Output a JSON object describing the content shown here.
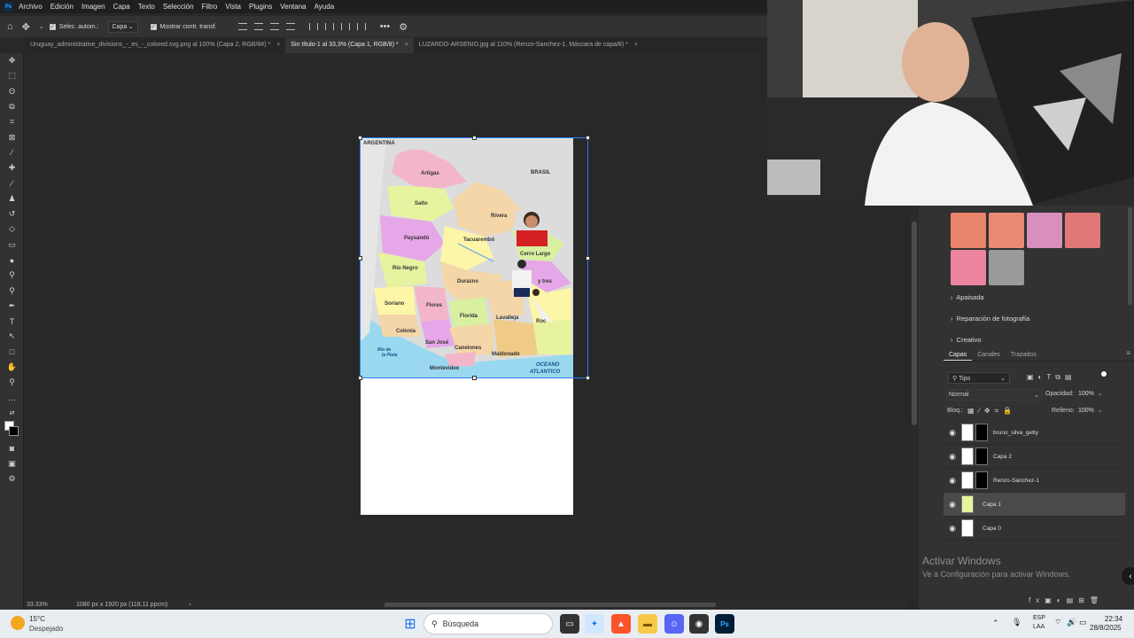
{
  "menu": [
    "Archivo",
    "Edición",
    "Imagen",
    "Capa",
    "Texto",
    "Selección",
    "Filtro",
    "Vista",
    "Plugins",
    "Ventana",
    "Ayuda"
  ],
  "options": {
    "autoselect_label": "Selec. autom.:",
    "autoselect_target": "Capa",
    "transform_label": "Mostrar contr. transf."
  },
  "tabs": [
    {
      "label": "Uruguay_administrative_divisions_-_es_-_colored.svg.png al 100% (Capa 2, RGB/8#) *"
    },
    {
      "label": "Sin título-1 al 33,3% (Capa 1, RGB/8) *"
    },
    {
      "label": "LUZARDO-ARSENIO.jpg al 110% (Renzo-Sanchez-1, Máscara de capa/8) *"
    }
  ],
  "map": {
    "labels": {
      "argentina": "ARGENTINA",
      "brasil": "BRASIL",
      "artigas": "Artigas",
      "salto": "Salto",
      "rivera": "Rivera",
      "paysandu": "Paysandú",
      "tacuarembo": "Tacuarembó",
      "cerro_largo": "Cerro Largo",
      "rio_negro": "Río Negro",
      "durazno": "Durazno",
      "treinta_y_tres": "y tres",
      "soriano": "Soriano",
      "flores": "Flores",
      "florida": "Florida",
      "lavalleja": "Lavalleja",
      "rocha": "Roc",
      "colonia": "Colonia",
      "san_jose": "San José",
      "canelones": "Canelones",
      "maldonado": "Maldonado",
      "montevideo": "Montevideo",
      "rio_de_la_plata_1": "Río de",
      "rio_de_la_plata_2": "la Plata",
      "oceano_1": "OCEANO",
      "oceano_2": "ATLANTICO"
    }
  },
  "status": {
    "zoom": "33.33%",
    "doc_size": "1080 px x 1920 px (118,11 ppcm)"
  },
  "adjustments": {
    "sections": [
      "Apaisada",
      "Reparación de fotografía",
      "Creativo"
    ]
  },
  "layers_panel": {
    "tabs": [
      "Capas",
      "Canales",
      "Trazados"
    ],
    "filter": "Tipo",
    "blend_mode": "Normal",
    "opacity_label": "Opacidad:",
    "opacity_value": "100%",
    "lock_label": "Bloq.:",
    "fill_label": "Relleno:",
    "fill_value": "100%",
    "layers": [
      {
        "name": "bruno_silva_getty",
        "mask": true,
        "selected": false
      },
      {
        "name": "Capa 2",
        "mask": true,
        "selected": false
      },
      {
        "name": "Renzo-Sanchez-1",
        "mask": true,
        "selected": false
      },
      {
        "name": "Capa 1",
        "mask": false,
        "selected": true
      },
      {
        "name": "Capa 0",
        "mask": false,
        "selected": false
      }
    ]
  },
  "watermark": {
    "line1": "Activar Windows",
    "line2": "Ve a Configuración para activar Windows."
  },
  "taskbar": {
    "temp": "15°C",
    "weather": "Despejado",
    "search": "Búsqueda",
    "lang1": "ESP",
    "lang2": "LAA",
    "time": "22:34",
    "date": "28/8/2025"
  }
}
